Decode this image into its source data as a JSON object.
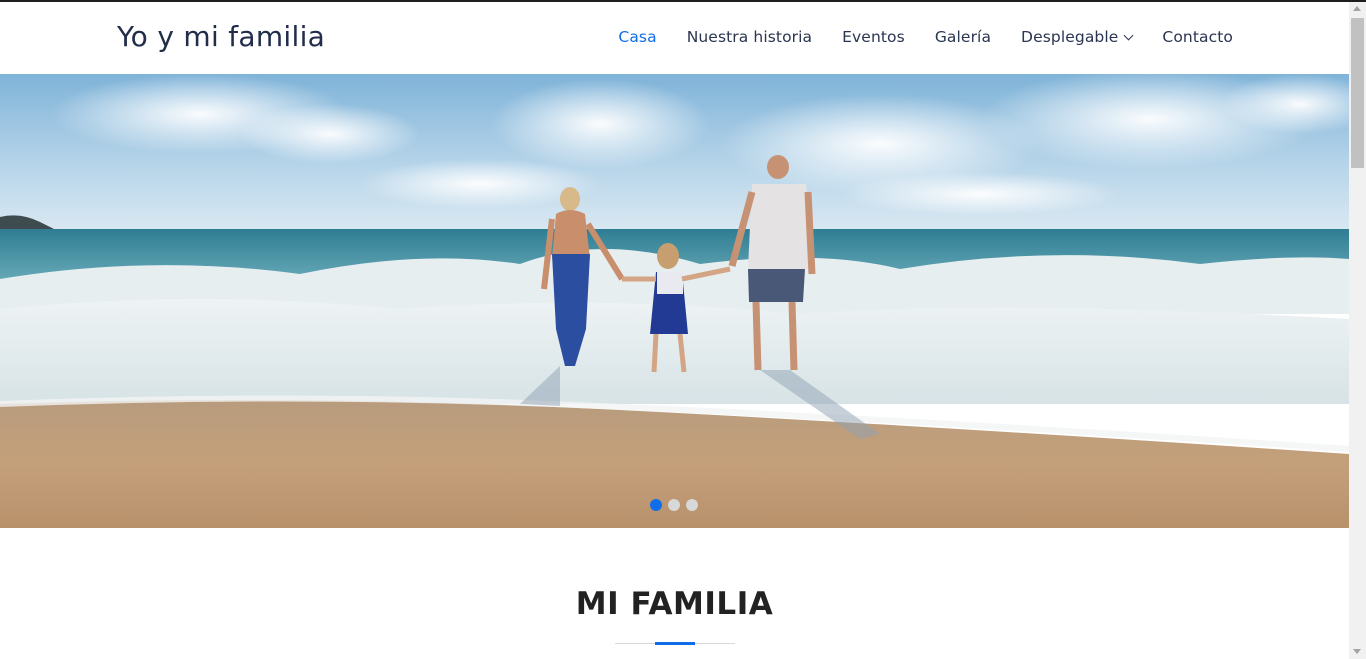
{
  "header": {
    "logo": "Yo y mi familia",
    "nav": [
      {
        "label": "Casa",
        "active": true
      },
      {
        "label": "Nuestra historia"
      },
      {
        "label": "Eventos"
      },
      {
        "label": "Galería"
      },
      {
        "label": "Desplegable",
        "dropdown": true
      },
      {
        "label": "Contacto"
      }
    ]
  },
  "hero": {
    "image": "family-holding-hands-beach-photo",
    "slides_count": 3,
    "active_slide": 1
  },
  "section": {
    "title": "MI FAMILIA"
  },
  "colors": {
    "accent": "#106eea",
    "text_dark": "#222d4a"
  }
}
